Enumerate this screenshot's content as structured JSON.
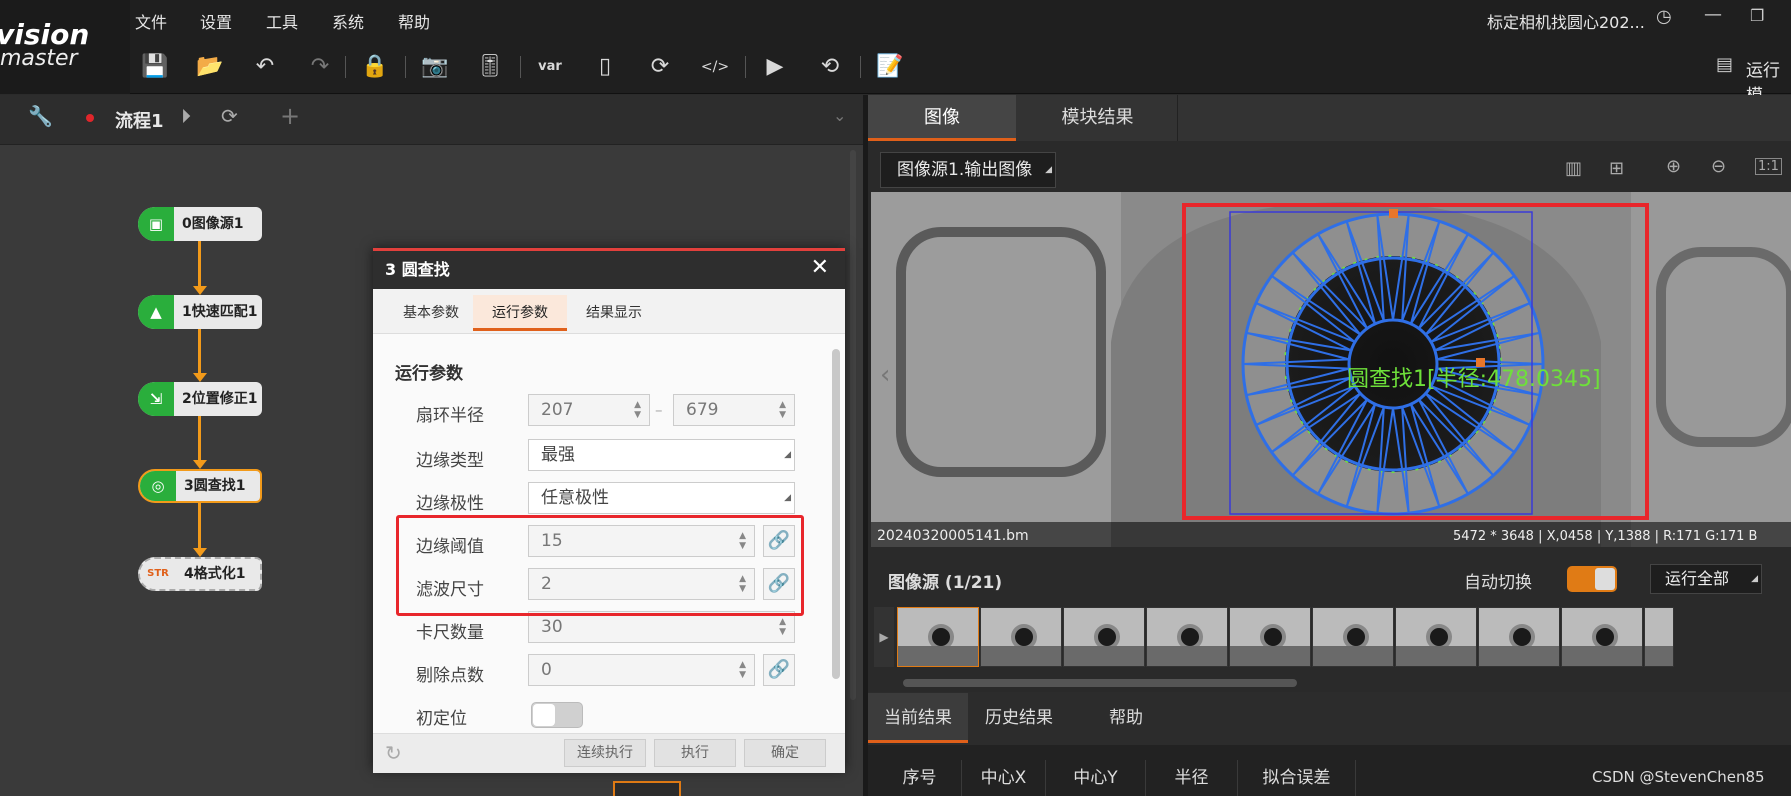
{
  "logo": {
    "line1": "vision",
    "line2": "master"
  },
  "menu": {
    "file": "文件",
    "settings": "设置",
    "tools": "工具",
    "system": "系统",
    "help": "帮助"
  },
  "window_title": "标定相机找圆心202...",
  "run_area_label": "运行模",
  "flow": {
    "tab_label": "流程1",
    "nodes": [
      {
        "label": "0图像源1"
      },
      {
        "label": "1快速匹配1"
      },
      {
        "label": "2位置修正1"
      },
      {
        "label": "3圆查找1"
      },
      {
        "label": "4格式化1"
      }
    ]
  },
  "dialog": {
    "title": "3 圆查找",
    "tabs": [
      "基本参数",
      "运行参数",
      "结果显示"
    ],
    "active_tab": 1,
    "section": "运行参数",
    "rows": {
      "sector_radius": {
        "label": "扇环半径",
        "min": "207",
        "dash": "–",
        "max": "679"
      },
      "edge_type": {
        "label": "边缘类型",
        "value": "最强"
      },
      "edge_polarity": {
        "label": "边缘极性",
        "value": "任意极性"
      },
      "edge_threshold": {
        "label": "边缘阈值",
        "value": "15"
      },
      "filter_size": {
        "label": "滤波尺寸",
        "value": "2"
      },
      "caliper_count": {
        "label": "卡尺数量",
        "value": "30"
      },
      "reject_points": {
        "label": "剔除点数",
        "value": "0"
      },
      "initial_position": {
        "label": "初定位",
        "enabled": false
      }
    },
    "buttons": {
      "continuous": "连续执行",
      "execute": "执行",
      "confirm": "确定"
    }
  },
  "right": {
    "tabs": [
      "图像",
      "模块结果"
    ],
    "active_tab": 0,
    "image_source_select": "图像源1.输出图像",
    "overlay_label": "圆查找1[半径:478.0345]",
    "status": {
      "filename": "20240320005141.bm",
      "info": "5472 * 3648  |  X,0458  |  Y,1388  |  R:171  G:171  B"
    },
    "image_source_header": "图像源 (1/21)",
    "auto_switch_label": "自动切换",
    "run_all_label": "运行全部",
    "result_tabs": [
      "当前结果",
      "历史结果",
      "帮助"
    ],
    "columns": [
      "序号",
      "中心X",
      "中心Y",
      "半径",
      "拟合误差"
    ]
  },
  "watermark": "CSDN @StevenChen85",
  "colors": {
    "accent_orange": "#f29a1a",
    "node_green": "#2aae3c",
    "highlight_red": "#e8262b",
    "caliper_blue": "#2f6fe6",
    "overlay_green": "#6ee03a"
  }
}
